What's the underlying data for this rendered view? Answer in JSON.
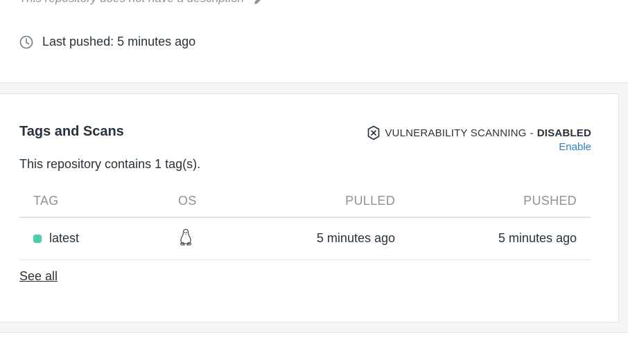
{
  "header": {
    "description": "This repository does not have a description",
    "last_pushed_label": "Last pushed:",
    "last_pushed_value": "5 minutes ago"
  },
  "tags_card": {
    "title": "Tags and Scans",
    "scanning_label": "VULNERABILITY SCANNING",
    "scanning_separator": "-",
    "scanning_state": "DISABLED",
    "enable_link": "Enable",
    "tag_count_text": "This repository contains 1 tag(s).",
    "columns": {
      "tag": "TAG",
      "os": "OS",
      "pulled": "PULLED",
      "pushed": "PUSHED"
    },
    "rows": [
      {
        "tag": "latest",
        "os_icon": "linux-icon",
        "pulled": "5 minutes ago",
        "pushed": "5 minutes ago",
        "status_color": "#4fcfa9"
      }
    ],
    "see_all": "See all"
  },
  "colors": {
    "link": "#2d7fc6",
    "muted": "#8a949c",
    "text": "#27323c",
    "border": "#dfe3e6"
  }
}
